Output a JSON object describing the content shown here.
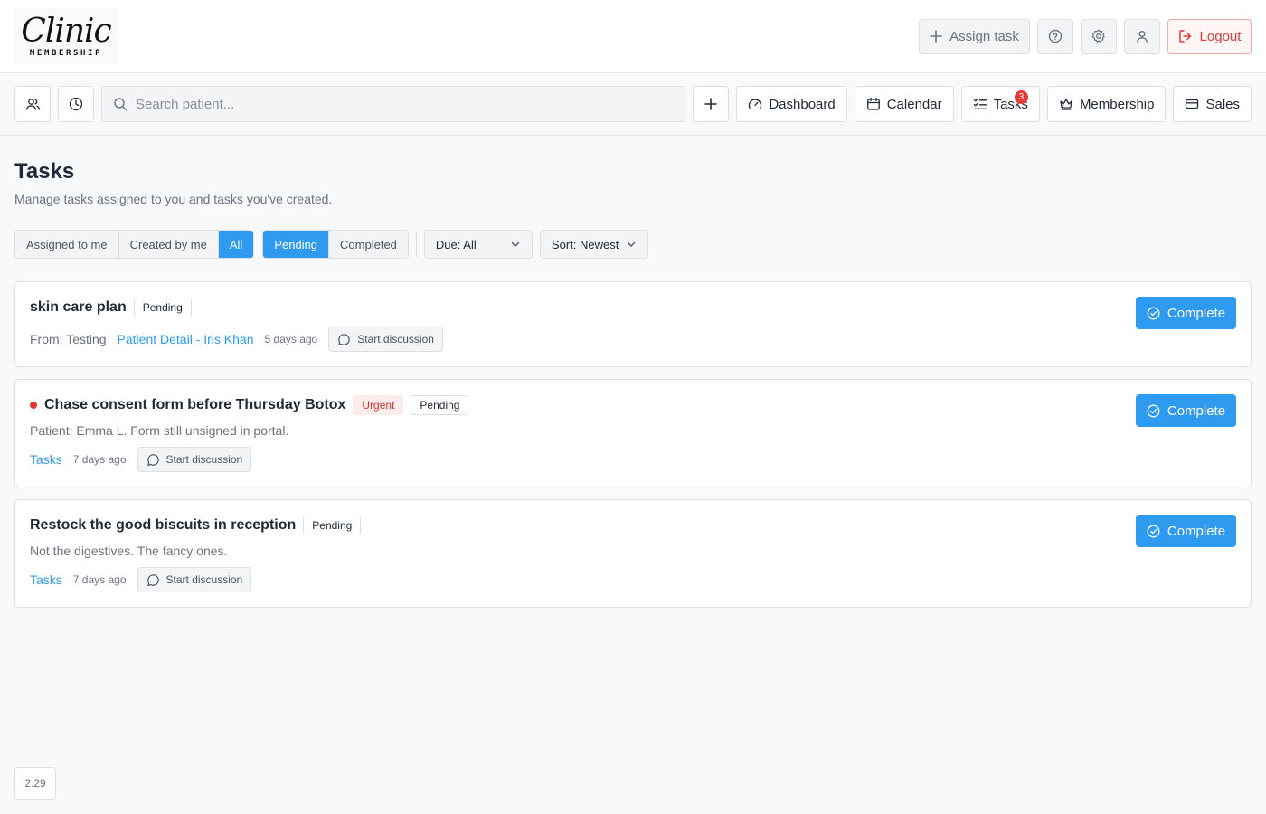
{
  "brand": {
    "logo_script": "Clinic",
    "logo_sub": "MEMBERSHIP"
  },
  "header": {
    "assign_label": "Assign task",
    "logout_label": "Logout",
    "icons": [
      "plus-icon",
      "help-icon",
      "gear-icon",
      "user-icon",
      "logout-icon"
    ]
  },
  "toolbar": {
    "search_placeholder": "Search patient...",
    "nav": {
      "dashboard": "Dashboard",
      "calendar": "Calendar",
      "tasks": "Tasks",
      "tasks_badge": "3",
      "membership": "Membership",
      "sales": "Sales"
    }
  },
  "page": {
    "title": "Tasks",
    "subtitle": "Manage tasks assigned to you and tasks you've created."
  },
  "filters": {
    "scope": [
      "Assigned to me",
      "Created by me",
      "All"
    ],
    "scope_active": "All",
    "status": [
      "Pending",
      "Completed"
    ],
    "status_active": "Pending",
    "due_label": "Due: All",
    "sort_label": "Sort: Newest"
  },
  "tasks": [
    {
      "title": "skin care plan",
      "status": "Pending",
      "from": "From: Testing",
      "link": "Patient Detail - Iris Khan",
      "age": "5 days ago",
      "discussion": "Start discussion",
      "action": "Complete"
    },
    {
      "title": "Chase consent form before Thursday Botox",
      "priority": "Urgent",
      "status": "Pending",
      "description": "Patient: Emma L. Form still unsigned in portal.",
      "link": "Tasks",
      "age": "7 days ago",
      "discussion": "Start discussion",
      "action": "Complete"
    },
    {
      "title": "Restock the good biscuits in reception",
      "status": "Pending",
      "description": "Not the digestives. The fancy ones.",
      "link": "Tasks",
      "age": "7 days ago",
      "discussion": "Start discussion",
      "action": "Complete"
    }
  ],
  "footer": {
    "version": "2.29"
  },
  "colors": {
    "accent": "#2f9bf0",
    "danger": "#e53935",
    "urgent_text": "#d9342b"
  }
}
